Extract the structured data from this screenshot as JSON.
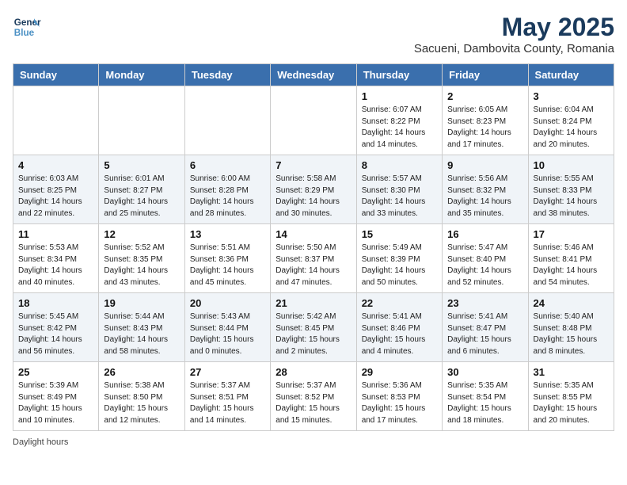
{
  "logo": {
    "line1": "General",
    "line2": "Blue"
  },
  "title": {
    "month_year": "May 2025",
    "location": "Sacueni, Dambovita County, Romania"
  },
  "weekdays": [
    "Sunday",
    "Monday",
    "Tuesday",
    "Wednesday",
    "Thursday",
    "Friday",
    "Saturday"
  ],
  "weeks": [
    [
      {
        "day": "",
        "info": ""
      },
      {
        "day": "",
        "info": ""
      },
      {
        "day": "",
        "info": ""
      },
      {
        "day": "",
        "info": ""
      },
      {
        "day": "1",
        "info": "Sunrise: 6:07 AM\nSunset: 8:22 PM\nDaylight: 14 hours\nand 14 minutes."
      },
      {
        "day": "2",
        "info": "Sunrise: 6:05 AM\nSunset: 8:23 PM\nDaylight: 14 hours\nand 17 minutes."
      },
      {
        "day": "3",
        "info": "Sunrise: 6:04 AM\nSunset: 8:24 PM\nDaylight: 14 hours\nand 20 minutes."
      }
    ],
    [
      {
        "day": "4",
        "info": "Sunrise: 6:03 AM\nSunset: 8:25 PM\nDaylight: 14 hours\nand 22 minutes."
      },
      {
        "day": "5",
        "info": "Sunrise: 6:01 AM\nSunset: 8:27 PM\nDaylight: 14 hours\nand 25 minutes."
      },
      {
        "day": "6",
        "info": "Sunrise: 6:00 AM\nSunset: 8:28 PM\nDaylight: 14 hours\nand 28 minutes."
      },
      {
        "day": "7",
        "info": "Sunrise: 5:58 AM\nSunset: 8:29 PM\nDaylight: 14 hours\nand 30 minutes."
      },
      {
        "day": "8",
        "info": "Sunrise: 5:57 AM\nSunset: 8:30 PM\nDaylight: 14 hours\nand 33 minutes."
      },
      {
        "day": "9",
        "info": "Sunrise: 5:56 AM\nSunset: 8:32 PM\nDaylight: 14 hours\nand 35 minutes."
      },
      {
        "day": "10",
        "info": "Sunrise: 5:55 AM\nSunset: 8:33 PM\nDaylight: 14 hours\nand 38 minutes."
      }
    ],
    [
      {
        "day": "11",
        "info": "Sunrise: 5:53 AM\nSunset: 8:34 PM\nDaylight: 14 hours\nand 40 minutes."
      },
      {
        "day": "12",
        "info": "Sunrise: 5:52 AM\nSunset: 8:35 PM\nDaylight: 14 hours\nand 43 minutes."
      },
      {
        "day": "13",
        "info": "Sunrise: 5:51 AM\nSunset: 8:36 PM\nDaylight: 14 hours\nand 45 minutes."
      },
      {
        "day": "14",
        "info": "Sunrise: 5:50 AM\nSunset: 8:37 PM\nDaylight: 14 hours\nand 47 minutes."
      },
      {
        "day": "15",
        "info": "Sunrise: 5:49 AM\nSunset: 8:39 PM\nDaylight: 14 hours\nand 50 minutes."
      },
      {
        "day": "16",
        "info": "Sunrise: 5:47 AM\nSunset: 8:40 PM\nDaylight: 14 hours\nand 52 minutes."
      },
      {
        "day": "17",
        "info": "Sunrise: 5:46 AM\nSunset: 8:41 PM\nDaylight: 14 hours\nand 54 minutes."
      }
    ],
    [
      {
        "day": "18",
        "info": "Sunrise: 5:45 AM\nSunset: 8:42 PM\nDaylight: 14 hours\nand 56 minutes."
      },
      {
        "day": "19",
        "info": "Sunrise: 5:44 AM\nSunset: 8:43 PM\nDaylight: 14 hours\nand 58 minutes."
      },
      {
        "day": "20",
        "info": "Sunrise: 5:43 AM\nSunset: 8:44 PM\nDaylight: 15 hours\nand 0 minutes."
      },
      {
        "day": "21",
        "info": "Sunrise: 5:42 AM\nSunset: 8:45 PM\nDaylight: 15 hours\nand 2 minutes."
      },
      {
        "day": "22",
        "info": "Sunrise: 5:41 AM\nSunset: 8:46 PM\nDaylight: 15 hours\nand 4 minutes."
      },
      {
        "day": "23",
        "info": "Sunrise: 5:41 AM\nSunset: 8:47 PM\nDaylight: 15 hours\nand 6 minutes."
      },
      {
        "day": "24",
        "info": "Sunrise: 5:40 AM\nSunset: 8:48 PM\nDaylight: 15 hours\nand 8 minutes."
      }
    ],
    [
      {
        "day": "25",
        "info": "Sunrise: 5:39 AM\nSunset: 8:49 PM\nDaylight: 15 hours\nand 10 minutes."
      },
      {
        "day": "26",
        "info": "Sunrise: 5:38 AM\nSunset: 8:50 PM\nDaylight: 15 hours\nand 12 minutes."
      },
      {
        "day": "27",
        "info": "Sunrise: 5:37 AM\nSunset: 8:51 PM\nDaylight: 15 hours\nand 14 minutes."
      },
      {
        "day": "28",
        "info": "Sunrise: 5:37 AM\nSunset: 8:52 PM\nDaylight: 15 hours\nand 15 minutes."
      },
      {
        "day": "29",
        "info": "Sunrise: 5:36 AM\nSunset: 8:53 PM\nDaylight: 15 hours\nand 17 minutes."
      },
      {
        "day": "30",
        "info": "Sunrise: 5:35 AM\nSunset: 8:54 PM\nDaylight: 15 hours\nand 18 minutes."
      },
      {
        "day": "31",
        "info": "Sunrise: 5:35 AM\nSunset: 8:55 PM\nDaylight: 15 hours\nand 20 minutes."
      }
    ]
  ],
  "footer": {
    "daylight_label": "Daylight hours"
  }
}
